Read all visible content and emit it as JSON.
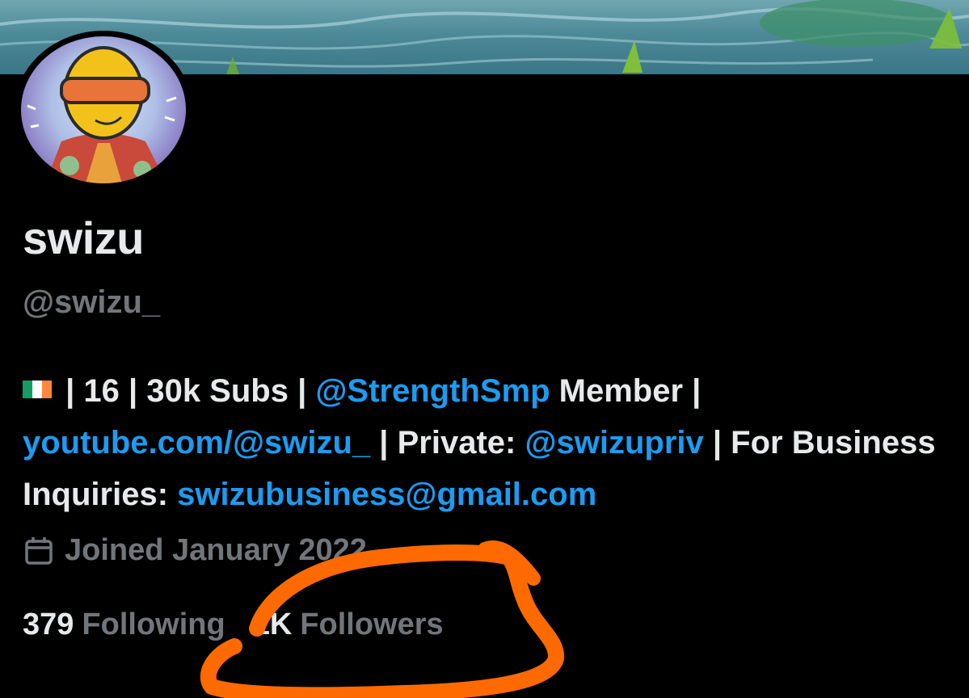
{
  "profile": {
    "display_name": "swizu",
    "handle": "@swizu_",
    "flag_icon": "ireland-flag-icon",
    "bio": {
      "sep_age": " | 16 | 30k Subs | ",
      "mention_1": "@StrengthSmp",
      "after_mention_1": " Member | ",
      "youtube_link": "youtube.com/@swizu_",
      "private_label": " | Private: ",
      "mention_2": "@swizupriv",
      "business_label": " | For Business Inquiries: ",
      "email": "swizubusiness@gmail.com"
    },
    "joined": "Joined January 2022",
    "following_count": "379",
    "following_label": "Following",
    "followers_count": "1K",
    "followers_label": "Followers"
  },
  "colors": {
    "background": "#000000",
    "text": "#e7e9ea",
    "muted": "#71767b",
    "link": "#1d9bf0",
    "scribble": "#ff6a00"
  }
}
